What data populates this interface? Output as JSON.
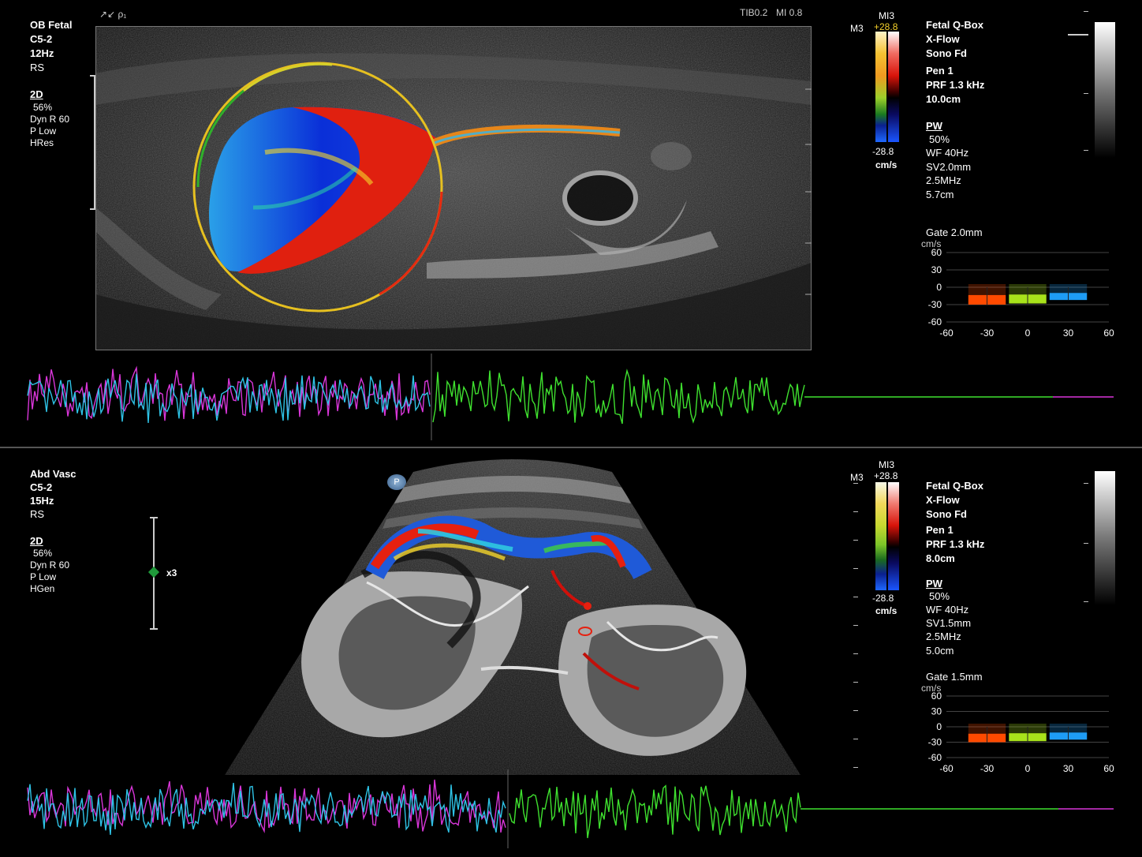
{
  "top": {
    "preset": "OB Fetal",
    "probe": "C5-2",
    "framerate": "12Hz",
    "mode_rs": "RS",
    "mode_2d": "2D",
    "gain": "56%",
    "dyn_range": "Dyn R 60",
    "power": "P Low",
    "res": "HRes",
    "header_left": "↗↙ ρ₁",
    "tib": "TIB0.2",
    "mi": "MI 0.8",
    "map_label_m3": "M3",
    "map_label_mi": "MI3",
    "scale_top": "+28.8",
    "scale_bottom": "-28.8",
    "scale_unit": "cm/s",
    "right_info": {
      "line1": "Fetal Q-Box",
      "line2": "X-Flow",
      "line3": "Sono Fd",
      "line4": "Pen 1",
      "line5": "PRF 1.3 kHz",
      "line6": "10.0cm",
      "pw": "PW",
      "pw1": "50%",
      "pw2": "WF 40Hz",
      "pw3": "SV2.0mm",
      "pw4": "2.5MHz",
      "pw5": "5.7cm"
    },
    "gate": "Gate 2.0mm",
    "chart_unit": "cm/s"
  },
  "bottom": {
    "preset": "Abd Vasc",
    "probe": "C5-2",
    "framerate": "15Hz",
    "mode_rs": "RS",
    "mode_2d": "2D",
    "gain": "56%",
    "dyn_range": "Dyn R 60",
    "power": "P Low",
    "res": "HGen",
    "zoom": "x3",
    "p_badge": "P",
    "map_label_m3": "M3",
    "map_label_mi": "MI3",
    "scale_top": "+28.8",
    "scale_bottom": "-28.8",
    "scale_unit": "cm/s",
    "right_info": {
      "line1": "Fetal Q-Box",
      "line2": "X-Flow",
      "line3": "Sono Fd",
      "line4": "Pen 1",
      "line5": "PRF 1.3 kHz",
      "line6": "8.0cm",
      "pw": "PW",
      "pw1": "50%",
      "pw2": "WF 40Hz",
      "pw3": "SV1.5mm",
      "pw4": "2.5MHz",
      "pw5": "5.0cm"
    },
    "gate": "Gate 1.5mm",
    "chart_unit": "cm/s"
  },
  "colors": {
    "orange_bar": "#ff4a00",
    "green_bar": "#a8e21b",
    "blue_bar": "#1e9cf5",
    "wave_magenta": "#d936d9",
    "wave_cyan": "#2ec3e6",
    "wave_green": "#3fe12f"
  },
  "chart_data": [
    {
      "type": "bar",
      "categories": [
        "-30",
        "0",
        "30"
      ],
      "values": [
        -30,
        -28,
        -22
      ],
      "x_ticks": [
        "-60",
        "-30",
        "0",
        "30",
        "60"
      ],
      "y_ticks": [
        "60",
        "30",
        "0",
        "-30",
        "-60"
      ],
      "ylim": [
        -60,
        60
      ],
      "xlim": [
        -60,
        60
      ],
      "ylabel": "cm/s",
      "grid": true
    },
    {
      "type": "bar",
      "categories": [
        "-30",
        "0",
        "30"
      ],
      "values": [
        -30,
        -28,
        -25
      ],
      "x_ticks": [
        "-60",
        "-30",
        "0",
        "30",
        "60"
      ],
      "y_ticks": [
        "60",
        "30",
        "0",
        "-30",
        "-60"
      ],
      "ylim": [
        -60,
        60
      ],
      "xlim": [
        -60,
        60
      ],
      "ylabel": "cm/s",
      "grid": true
    }
  ]
}
